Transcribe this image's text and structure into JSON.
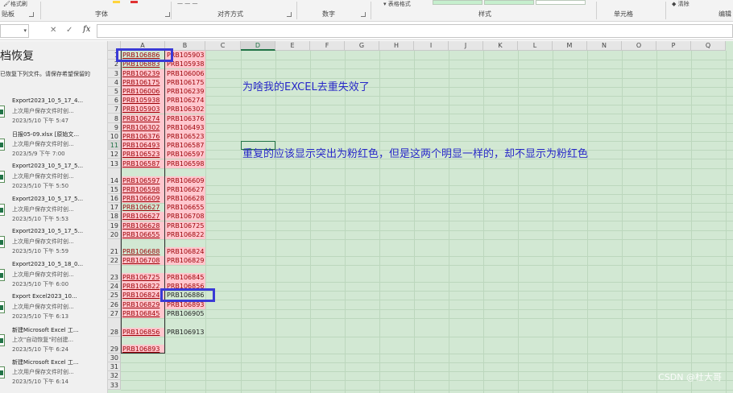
{
  "ribbon": {
    "format_painter": "格式刷",
    "clipboard_label": "贴板",
    "font_label": "字体",
    "alignment_label": "对齐方式",
    "number_label": "数字",
    "styles_label": "样式",
    "table_format": "表格格式",
    "cells_label": "单元格",
    "clear_label": "清除",
    "editing_label": "编辑"
  },
  "formula_bar": {
    "cancel": "✕",
    "enter": "✓",
    "fx": "fx",
    "value": ""
  },
  "recovery": {
    "title": "档恢复",
    "subtitle": "已恢复下列文件。请保存希望保留的",
    "files": [
      {
        "name": "Export2023_10_5_17_4...",
        "desc": "上次用户保存文件时创...",
        "date": "2023/5/10 下午 5:47"
      },
      {
        "name": "日报05-09.xlsx [原始文...",
        "desc": "上次用户保存文件时创...",
        "date": "2023/5/9 下午 7:00"
      },
      {
        "name": "Export2023_10_5_17_5...",
        "desc": "上次用户保存文件时创...",
        "date": "2023/5/10 下午 5:50"
      },
      {
        "name": "Export2023_10_5_17_5...",
        "desc": "上次用户保存文件时创...",
        "date": "2023/5/10 下午 5:53"
      },
      {
        "name": "Export2023_10_5_17_5...",
        "desc": "上次用户保存文件时创...",
        "date": "2023/5/10 下午 5:59"
      },
      {
        "name": "Export2023_10_5_18_0...",
        "desc": "上次用户保存文件时创...",
        "date": "2023/5/10 下午 6:00"
      },
      {
        "name": "Export Excel2023_10...",
        "desc": "上次用户保存文件时创...",
        "date": "2023/5/10 下午 6:13"
      },
      {
        "name": "新建Microsoft Excel 工...",
        "desc": "上次\"自动恢复\"时创建...",
        "date": "2023/5/10 下午 6:24"
      },
      {
        "name": "新建Microsoft Excel 工...",
        "desc": "上次用户保存文件时创...",
        "date": "2023/5/10 下午 6:14"
      }
    ]
  },
  "sheet": {
    "columns": [
      "A",
      "B",
      "C",
      "D",
      "E",
      "F",
      "G",
      "H",
      "I",
      "J",
      "K",
      "L",
      "M",
      "N",
      "O",
      "P",
      "Q"
    ],
    "rows": [
      {
        "n": "1",
        "a": "PRB106886",
        "b": "PRB105903"
      },
      {
        "n": "2",
        "a": "PRB106883",
        "b": "PRB105938"
      },
      {
        "n": "3",
        "a": "PRB106239",
        "b": "PRB106006"
      },
      {
        "n": "4",
        "a": "PRB106175",
        "b": "PRB106175"
      },
      {
        "n": "5",
        "a": "PRB106006",
        "b": "PRB106239"
      },
      {
        "n": "6",
        "a": "PRB105938",
        "b": "PRB106274"
      },
      {
        "n": "7",
        "a": "PRB105903",
        "b": "PRB106302"
      },
      {
        "n": "8",
        "a": "PRB106274",
        "b": "PRB106376"
      },
      {
        "n": "9",
        "a": "PRB106302",
        "b": "PRB106493"
      },
      {
        "n": "10",
        "a": "PRB106376",
        "b": "PRB106523"
      },
      {
        "n": "11",
        "a": "PRB106493",
        "b": "PRB106587"
      },
      {
        "n": "12",
        "a": "PRB106523",
        "b": "PRB106597"
      },
      {
        "n": "13",
        "a": "PRB106587",
        "b": "PRB106598"
      },
      {
        "n": "14",
        "a": "PRB106597",
        "b": "PRB106609"
      },
      {
        "n": "15",
        "a": "PRB106598",
        "b": "PRB106627"
      },
      {
        "n": "16",
        "a": "PRB106609",
        "b": "PRB106628"
      },
      {
        "n": "17",
        "a": "PRB106627",
        "b": "PRB106655"
      },
      {
        "n": "18",
        "a": "PRB106627",
        "b": "PRB106708"
      },
      {
        "n": "19",
        "a": "PRB106628",
        "b": "PRB106725"
      },
      {
        "n": "20",
        "a": "PRB106655",
        "b": "PRB106822"
      },
      {
        "n": "21",
        "a": "PRB106688",
        "b": "PRB106824"
      },
      {
        "n": "22",
        "a": "PRB106708",
        "b": "PRB106829"
      },
      {
        "n": "23",
        "a": "PRB106725",
        "b": "PRB106845"
      },
      {
        "n": "24",
        "a": "PRB106822",
        "b": "PRB106856"
      },
      {
        "n": "25",
        "a": "PRB106824",
        "b": "PRB106886"
      },
      {
        "n": "26",
        "a": "PRB106829",
        "b": "PRB106893"
      },
      {
        "n": "27",
        "a": "PRB106845",
        "b": "PRB106905"
      },
      {
        "n": "28",
        "a": "PRB106856",
        "b": "PRB106913"
      },
      {
        "n": "29",
        "a": "PRB106893",
        "b": ""
      },
      {
        "n": "30",
        "a": "",
        "b": ""
      },
      {
        "n": "31",
        "a": "",
        "b": ""
      },
      {
        "n": "32",
        "a": "",
        "b": ""
      },
      {
        "n": "33",
        "a": "",
        "b": ""
      }
    ],
    "note1": "为啥我的EXCEL去重失效了",
    "note2": "重复的应该显示突出为粉红色，但是这两个明显一样的，却不显示为粉红色"
  },
  "watermark": "CSDN @杜大哥",
  "colors": {
    "duplicate_fill": "#ffc7ce",
    "duplicate_text": "#9c0006",
    "annotation": "#2828c8",
    "sheet_bg": "#d2e8d3"
  }
}
